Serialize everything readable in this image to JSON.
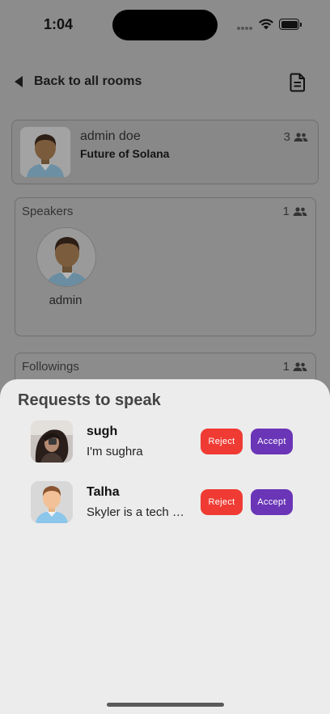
{
  "status_bar": {
    "time": "1:04"
  },
  "header": {
    "back_label": "Back to all rooms",
    "doc_icon": "document-icon"
  },
  "room": {
    "host_name": "admin doe",
    "title": "Future of Solana",
    "member_count": "3"
  },
  "speakers": {
    "label": "Speakers",
    "count": "1",
    "items": [
      {
        "name": "admin"
      }
    ]
  },
  "followings": {
    "label": "Followings",
    "count": "1"
  },
  "sheet": {
    "title": "Requests to speak",
    "requests": [
      {
        "name": "sugh",
        "bio": "I'm sughra",
        "reject_label": "Reject",
        "accept_label": "Accept"
      },
      {
        "name": "Talha",
        "bio": "Skyler is a tech enthusiast",
        "reject_label": "Reject",
        "accept_label": "Accept"
      }
    ]
  },
  "colors": {
    "reject": "#ef3b33",
    "accept": "#6a35b7",
    "overlay": "#8c8c8c",
    "sheet": "#ececec"
  }
}
